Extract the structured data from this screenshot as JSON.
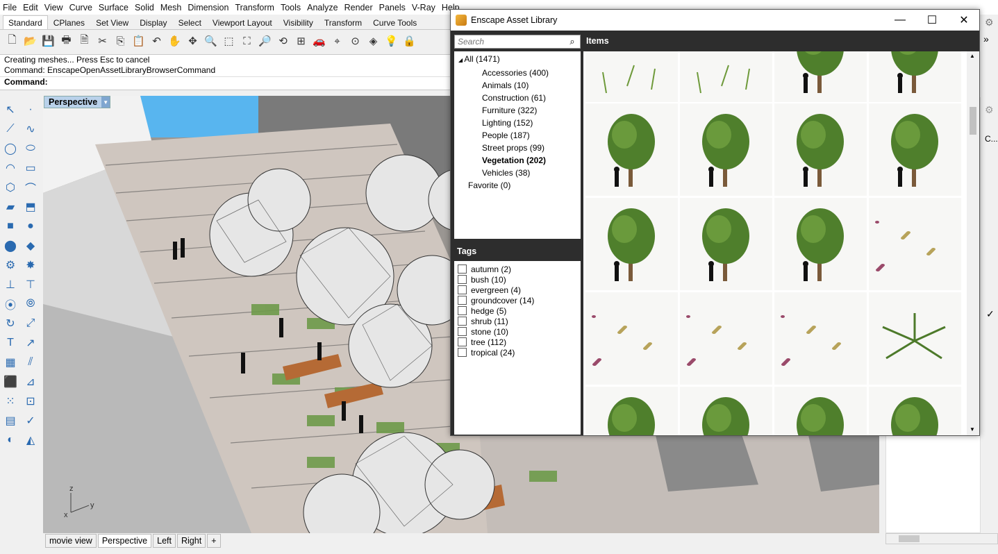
{
  "menubar": [
    "File",
    "Edit",
    "View",
    "Curve",
    "Surface",
    "Solid",
    "Mesh",
    "Dimension",
    "Transform",
    "Tools",
    "Analyze",
    "Render",
    "Panels",
    "V-Ray",
    "Help"
  ],
  "tabs": [
    "Standard",
    "CPlanes",
    "Set View",
    "Display",
    "Select",
    "Viewport Layout",
    "Visibility",
    "Transform",
    "Curve Tools"
  ],
  "active_tab": "Standard",
  "command_history": [
    "Creating meshes... Press Esc to cancel",
    "Command: EnscapeOpenAssetLibraryBrowserCommand"
  ],
  "command_prompt": "Command:",
  "viewport": {
    "label": "Perspective",
    "axes": {
      "x": "x",
      "y": "y",
      "z": "z"
    }
  },
  "viewport_tabs": [
    "movie view",
    "Perspective",
    "Left",
    "Right"
  ],
  "add_tab_symbol": "+",
  "right_panel": {
    "label": "C..."
  },
  "asset_library": {
    "title": "Enscape Asset Library",
    "search_placeholder": "Search",
    "categories": [
      {
        "label": "All (1471)",
        "level": 0,
        "bold": false
      },
      {
        "label": "Accessories (400)",
        "level": 1,
        "bold": false
      },
      {
        "label": "Animals (10)",
        "level": 1,
        "bold": false
      },
      {
        "label": "Construction (61)",
        "level": 1,
        "bold": false
      },
      {
        "label": "Furniture (322)",
        "level": 1,
        "bold": false
      },
      {
        "label": "Lighting (152)",
        "level": 1,
        "bold": false
      },
      {
        "label": "People (187)",
        "level": 1,
        "bold": false
      },
      {
        "label": "Street props (99)",
        "level": 1,
        "bold": false
      },
      {
        "label": "Vegetation (202)",
        "level": 1,
        "bold": true
      },
      {
        "label": "Vehicles (38)",
        "level": 1,
        "bold": false
      },
      {
        "label": "Favorite (0)",
        "level": 0,
        "bold": false
      }
    ],
    "tags_header": "Tags",
    "tags": [
      "autumn (2)",
      "bush (10)",
      "evergreen (4)",
      "groundcover (14)",
      "hedge (5)",
      "shrub (11)",
      "stone (10)",
      "tree (112)",
      "tropical (24)"
    ],
    "items_header": "Items"
  },
  "colors": {
    "header_bg": "#2d2d2d",
    "sky": "#58b5ef",
    "tab_active_bg": "#ffffff",
    "viewport_label_bg": "#b9d1ea"
  }
}
